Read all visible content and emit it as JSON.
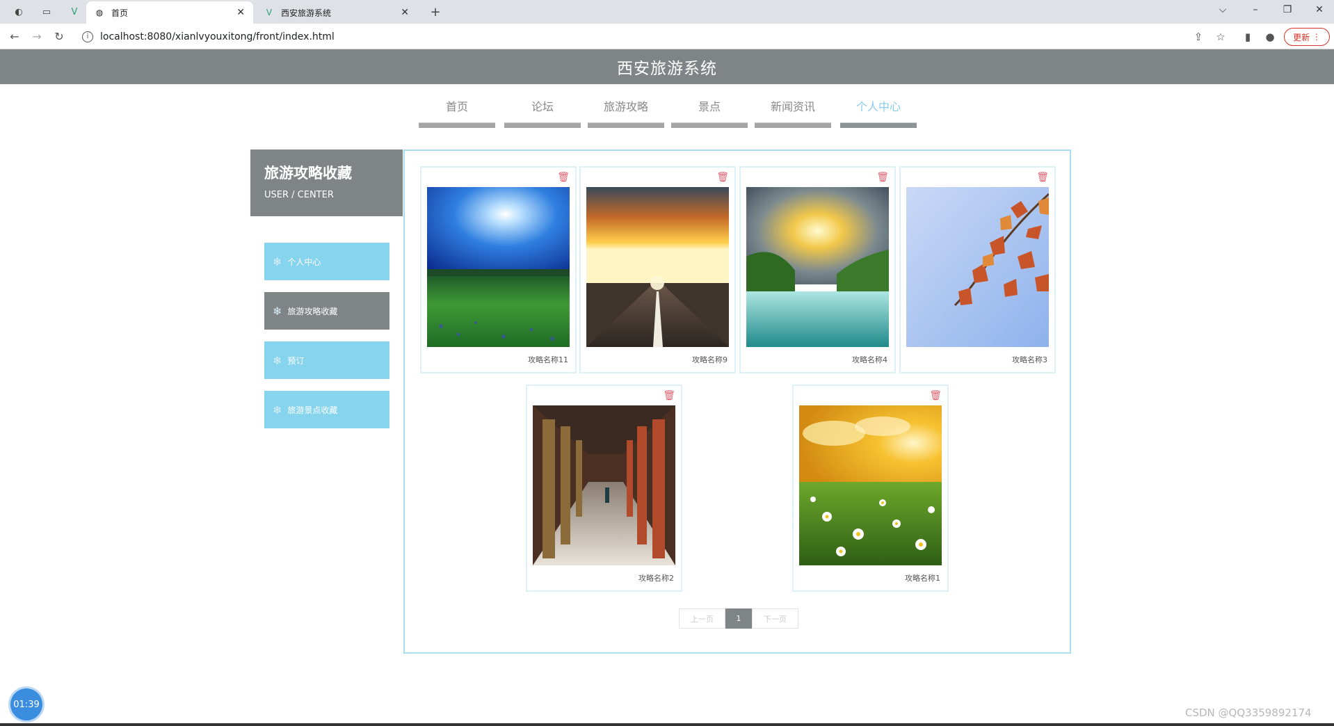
{
  "browser": {
    "tabs": [
      {
        "title": "首页",
        "active": true
      },
      {
        "title": "西安旅游系统",
        "active": false
      }
    ],
    "url": "localhost:8080/xianlvyouxitong/front/index.html",
    "update_label": "更新"
  },
  "site": {
    "title": "西安旅游系统"
  },
  "nav": {
    "items": [
      {
        "label": "首页"
      },
      {
        "label": "论坛"
      },
      {
        "label": "旅游攻略"
      },
      {
        "label": "景点"
      },
      {
        "label": "新闻资讯"
      },
      {
        "label": "个人中心",
        "active": true
      }
    ]
  },
  "sidebar": {
    "title": "旅游攻略收藏",
    "subtitle": "USER / CENTER",
    "items": [
      {
        "label": "个人中心"
      },
      {
        "label": "旅游攻略收藏",
        "active": true
      },
      {
        "label": "预订"
      },
      {
        "label": "旅游景点收藏"
      }
    ]
  },
  "favorites": {
    "cards": [
      {
        "name": "攻略名称11",
        "image": "blue-sky-grass-field"
      },
      {
        "name": "攻略名称9",
        "image": "sunset-road"
      },
      {
        "name": "攻略名称4",
        "image": "lake-mountains-sunrise"
      },
      {
        "name": "攻略名称3",
        "image": "autumn-leaves-sky"
      },
      {
        "name": "攻略名称2",
        "image": "red-pillar-corridor"
      },
      {
        "name": "攻略名称1",
        "image": "daisy-field-sunset"
      }
    ]
  },
  "pagination": {
    "prev": "上一页",
    "current": "1",
    "next": "下一页"
  },
  "overlay": {
    "timer": "01:39",
    "watermark": "CSDN @QQ3359892174"
  },
  "colors": {
    "header_bg": "#7f8486",
    "accent": "#87d4ee",
    "delete_icon": "#e0626f"
  }
}
